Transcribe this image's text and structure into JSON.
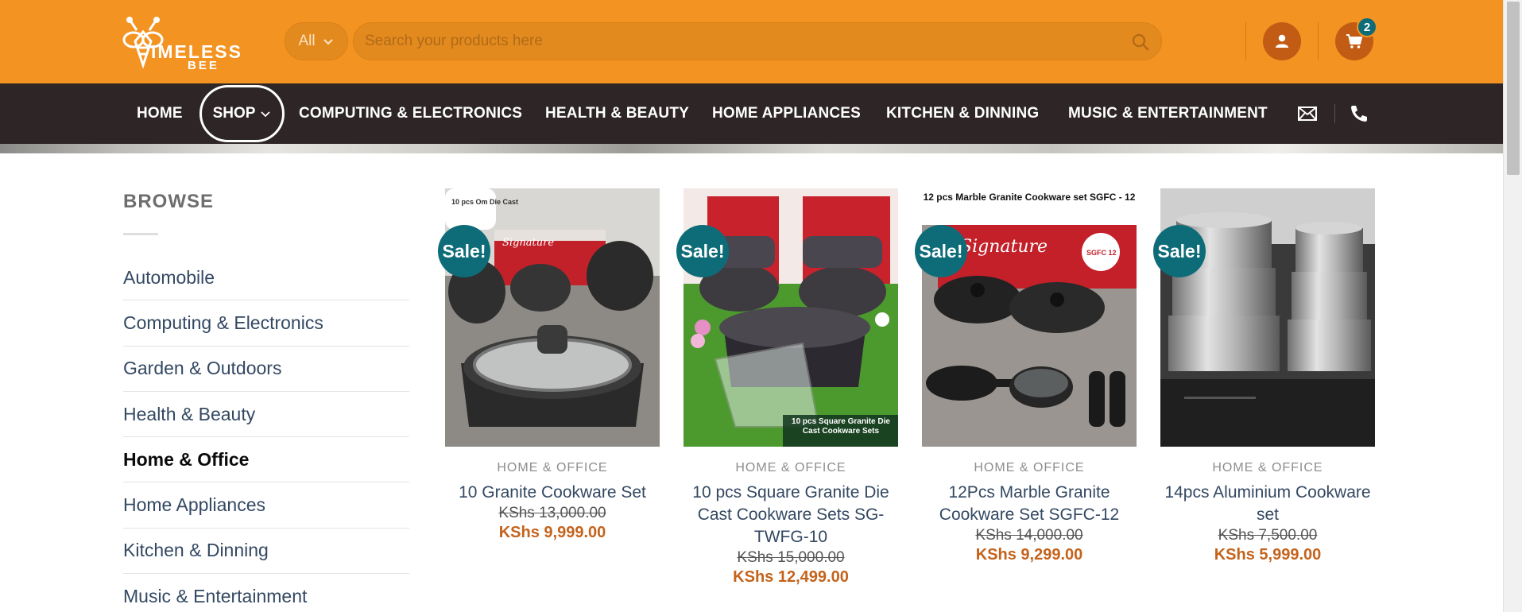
{
  "header": {
    "logo_word": "IMELESS",
    "logo_sub": "BEE",
    "category_select": "All",
    "search_placeholder": "Search your products here",
    "cart_count": "2"
  },
  "nav": {
    "items": [
      "HOME",
      "SHOP",
      "COMPUTING & ELECTRONICS",
      "HEALTH & BEAUTY",
      "HOME APPLIANCES",
      "KITCHEN & DINNING",
      "MUSIC & ENTERTAINMENT"
    ]
  },
  "sidebar": {
    "title": "BROWSE",
    "items": [
      "Automobile",
      "Computing & Electronics",
      "Garden & Outdoors",
      "Health & Beauty",
      "Home & Office",
      "Home Appliances",
      "Kitchen & Dinning",
      "Music & Entertainment"
    ],
    "active": "Home & Office"
  },
  "products": [
    {
      "badge": "Sale!",
      "category": "HOME & OFFICE",
      "name": "10 Granite Cookware Set",
      "old_price": "KShs 13,000.00",
      "new_price": "KShs 9,999.00"
    },
    {
      "badge": "Sale!",
      "category": "HOME & OFFICE",
      "name": "10 pcs Square Granite Die Cast Cookware Sets SG-TWFG-10",
      "old_price": "KShs 15,000.00",
      "new_price": "KShs 12,499.00"
    },
    {
      "badge": "Sale!",
      "category": "HOME & OFFICE",
      "name": "12Pcs Marble Granite Cookware Set SGFC-12",
      "old_price": "KShs 14,000.00",
      "new_price": "KShs 9,299.00"
    },
    {
      "badge": "Sale!",
      "category": "HOME & OFFICE",
      "name": "14pcs Aluminium Cookware set",
      "old_price": "KShs 7,500.00",
      "new_price": "KShs 5,999.00"
    }
  ],
  "product_images": {
    "p1_top_label": "10 pcs Om Die Cast",
    "p1_box_brand": "Signature",
    "p2_caption": "10 pcs Square Granite Die Cast Cookware Sets",
    "p3_top_caption": "12 pcs Marble Granite Cookware set SGFC - 12",
    "p3_box_brand": "Signature",
    "p3_box_code": "SGFC 12"
  },
  "colors": {
    "header_orange": "#f39321",
    "nav_dark": "#2e2626",
    "badge_teal": "#0e6c78",
    "price_orange": "#c4631b",
    "link_blue": "#334862"
  },
  "icons": [
    "chevron-down-icon",
    "search-icon",
    "user-icon",
    "cart-icon",
    "envelope-icon",
    "phone-icon"
  ]
}
